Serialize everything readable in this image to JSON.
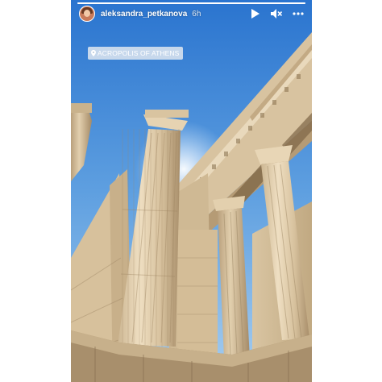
{
  "story": {
    "username": "aleksandra_petkanova",
    "time_ago": "6h",
    "progress_fraction": 1.0,
    "location_sticker": "ACROPOLIS OF ATHENS"
  },
  "icons": {
    "play": "play-icon",
    "mute": "speaker-muted-icon",
    "more": "more-options-icon",
    "location": "location-pin-icon"
  },
  "colors": {
    "sky_top": "#2f7fd6",
    "sky_bottom": "#9cc7ec",
    "marble_light": "#e8d7b8",
    "marble_shadow": "#b89e7a"
  }
}
